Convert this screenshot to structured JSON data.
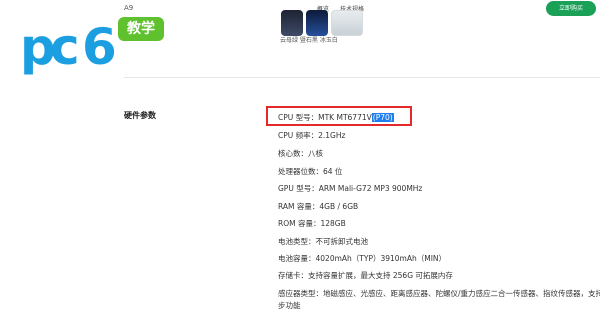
{
  "header": {
    "model": "A9",
    "nav": [
      "概览",
      "技术规格"
    ],
    "buy_label": "立即购买"
  },
  "colors_text": "云母绿 暨石黑 冰玉白",
  "watermark": {
    "logo_text": [
      "p",
      "c",
      "6"
    ],
    "badge": "教学"
  },
  "section": {
    "title": "硬件参数"
  },
  "specs": [
    {
      "text": "CPU 型号：MTK MT6771V",
      "highlight": "(P70)"
    },
    {
      "text": "CPU 频率：2.1GHz"
    },
    {
      "text": "核心数：八核"
    },
    {
      "text": "处理器位数：64 位"
    },
    {
      "text": "GPU 型号：ARM Mali-G72 MP3 900MHz"
    },
    {
      "text": "RAM 容量：4GB / 6GB"
    },
    {
      "text": "ROM 容量：128GB"
    },
    {
      "text": "电池类型：不可拆卸式电池"
    },
    {
      "text": "电池容量：4020mAh（TYP）3910mAh（MIN）"
    },
    {
      "text": "存储卡：支持容量扩展，最大支持 256G 可拓展内存"
    },
    {
      "text": "感应器类型：地磁感应、光感应、距离感应器、陀螺仪/重力感应二合一传感器、指纹传感器，支持计"
    },
    {
      "text": "步功能"
    }
  ],
  "theme": {
    "buy_color": "#1aa057",
    "logo_blue": "#1b9fe0",
    "badge_green": "#5ec12d",
    "highlight": "#1e7ff0",
    "annotation_red": "#e4292a"
  }
}
